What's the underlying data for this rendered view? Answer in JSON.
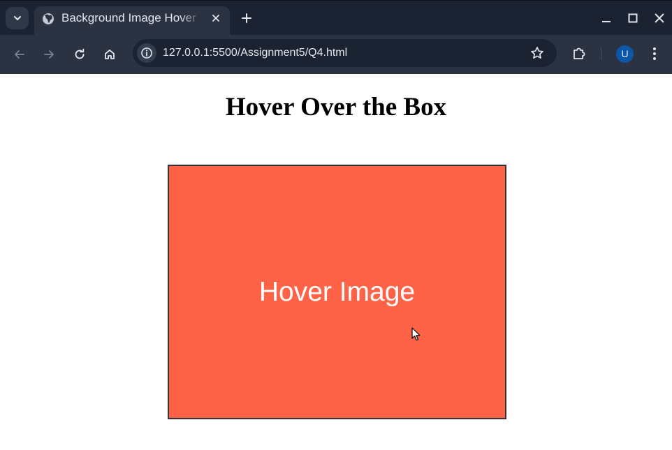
{
  "browser": {
    "tab_title": "Background Image Hover",
    "url": "127.0.0.1:5500/Assignment5/Q4.html",
    "profile_initial": "U"
  },
  "icons": {
    "tab_search": "chevron-down-icon",
    "favicon": "globe-icon",
    "tab_close": "close-icon",
    "new_tab": "plus-icon",
    "back": "arrow-left-icon",
    "forward": "arrow-right-icon",
    "reload": "reload-icon",
    "home": "home-icon",
    "site_info": "info-icon",
    "bookmark": "star-icon",
    "extensions": "puzzle-icon",
    "menu": "kebab-menu-icon"
  },
  "page": {
    "heading": "Hover Over the Box",
    "box_label": "Hover Image"
  },
  "colors": {
    "box_background": "#ff6347",
    "box_border": "#333333",
    "chrome_dark": "#1b2231",
    "chrome_toolbar": "#2b3343",
    "avatar": "#0b57a8"
  }
}
